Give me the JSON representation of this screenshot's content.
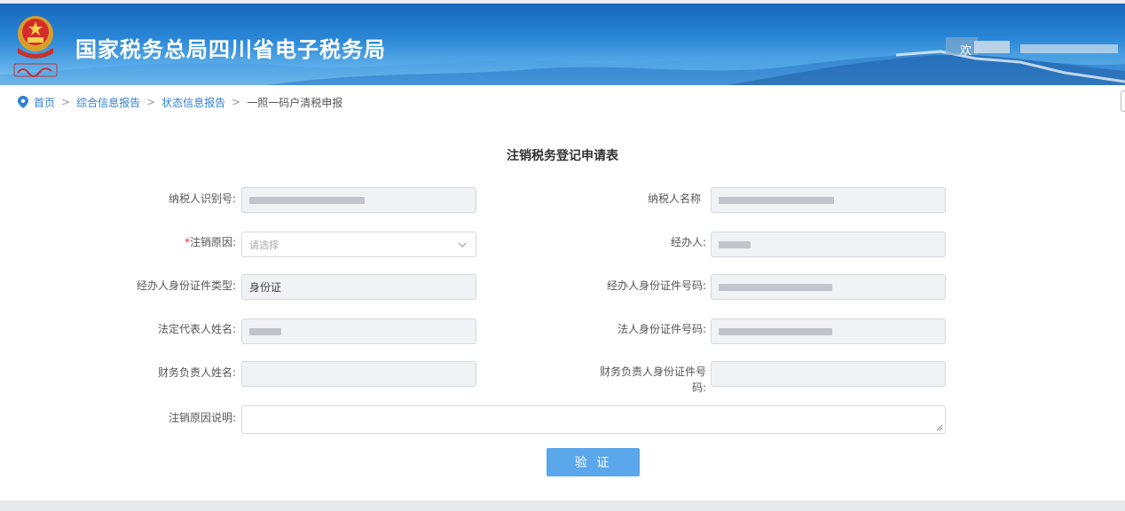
{
  "header": {
    "site_title": "国家税务总局四川省电子税务局",
    "welcome": "欢",
    "emblem_icon": "national-emblem-icon",
    "brand_color": "#2a86d6"
  },
  "breadcrumb": {
    "items": [
      "首页",
      "综合信息报告",
      "状态信息报告"
    ],
    "current": "一照一码户清税申报",
    "separator": ">"
  },
  "form": {
    "title": "注销税务登记申请表",
    "taxpayer_id_label": "纳税人识别号:",
    "taxpayer_name_label": "纳税人名称",
    "cancel_reason_label": "注销原因:",
    "cancel_reason_placeholder": "请选择",
    "agent_label": "经办人:",
    "agent_id_type_label": "经办人身份证件类型:",
    "agent_id_type_value": "身份证",
    "agent_id_number_label": "经办人身份证件号码:",
    "legal_rep_name_label": "法定代表人姓名:",
    "legal_id_number_label": "法人身份证件号码:",
    "finance_head_name_label": "财务负责人姓名:",
    "finance_head_id_label": "财务负责人身份证件号码:",
    "cancel_reason_desc_label": "注销原因说明:",
    "verify_button": "验 证",
    "required_mark": "*"
  }
}
